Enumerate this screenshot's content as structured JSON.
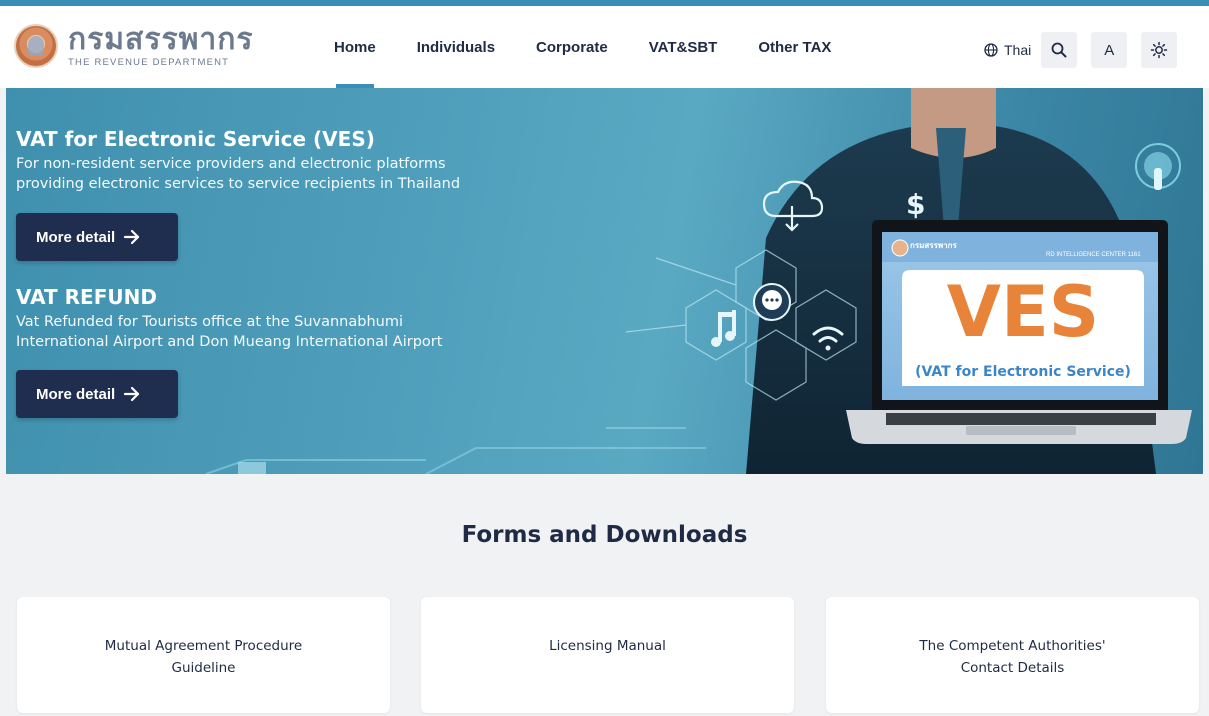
{
  "header": {
    "logo_thai": "กรมสรรพากร",
    "logo_en": "THE REVENUE DEPARTMENT",
    "nav": [
      "Home",
      "Individuals",
      "Corporate",
      "VAT&SBT",
      "Other TAX"
    ],
    "active_nav": "Home",
    "language_label": "Thai",
    "font_size_label": "A"
  },
  "hero": {
    "ves": {
      "title": "VAT for Electronic Service (VES)",
      "desc_line1": "For non-resident service providers and electronic platforms",
      "desc_line2": "providing electronic services to service recipients in Thailand",
      "button_label": "More detail"
    },
    "refund": {
      "title": "VAT REFUND",
      "desc_line1": "Vat Refunded for Tourists office at the Suvannabhumi",
      "desc_line2": "International Airport and Don Mueang International Airport",
      "button_label": "More detail"
    },
    "laptop": {
      "brand": "กรมสรรพากร",
      "contact": "RD INTELLIGENCE CENTER 1161",
      "big_text": "VES",
      "sub_text": "(VAT for Electronic Service)"
    }
  },
  "forms": {
    "title": "Forms and Downloads",
    "cards": [
      {
        "line1": "Mutual Agreement Procedure",
        "line2": "Guideline"
      },
      {
        "line1": "Licensing Manual",
        "line2": ""
      },
      {
        "line1": "The Competent Authorities'",
        "line2": "Contact Details"
      }
    ]
  },
  "colors": {
    "accent": "#3a8fb7",
    "navy": "#1f2d4f",
    "ves_orange": "#e8833a"
  },
  "icons": [
    "globe-icon",
    "search-icon",
    "brightness-icon",
    "arrow-right-icon",
    "cloud-download-icon",
    "dollar-icon",
    "chat-icon",
    "music-icon",
    "wifi-icon",
    "touch-icon"
  ]
}
